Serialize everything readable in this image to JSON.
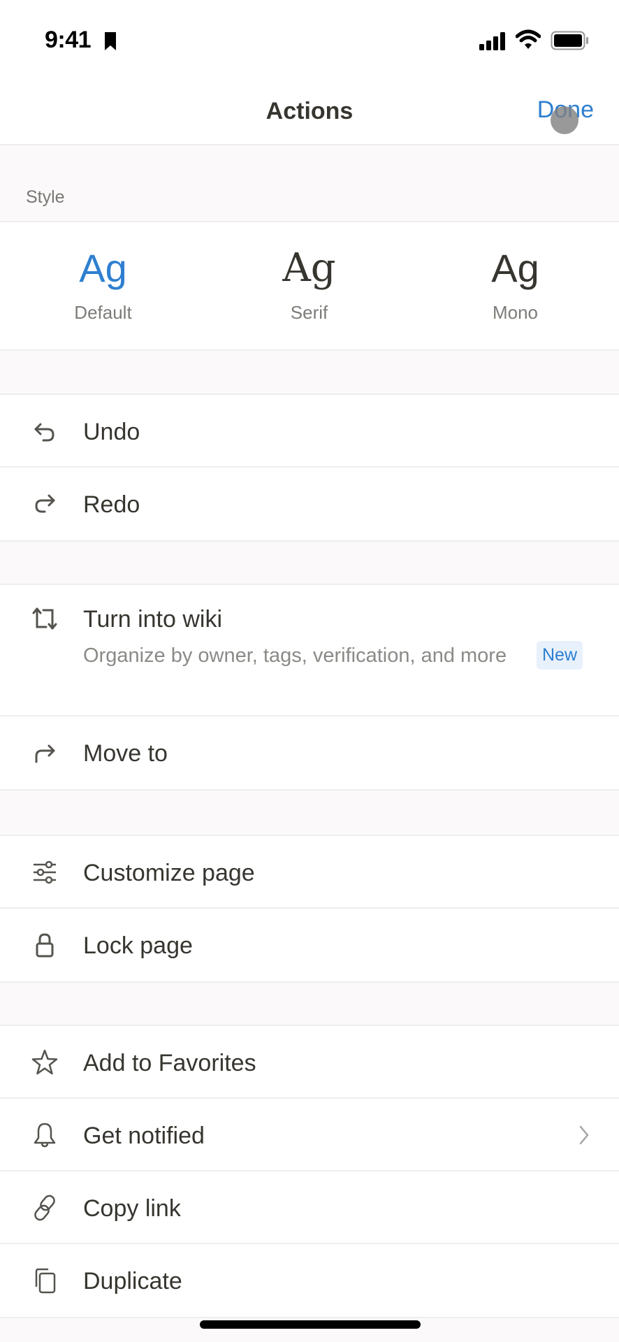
{
  "status_bar": {
    "time": "9:41",
    "icons": [
      "bookmark-icon",
      "cellular-signal-icon",
      "wifi-icon",
      "battery-icon"
    ]
  },
  "nav": {
    "title": "Actions",
    "done_label": "Done"
  },
  "style_section": {
    "header": "Style",
    "selected": "Default",
    "options": [
      {
        "glyph": "Ag",
        "label": "Default"
      },
      {
        "glyph": "Ag",
        "label": "Serif"
      },
      {
        "glyph": "Ag",
        "label": "Mono"
      }
    ]
  },
  "groups": [
    {
      "items": [
        {
          "icon": "undo-icon",
          "label": "Undo"
        },
        {
          "icon": "redo-icon",
          "label": "Redo"
        }
      ]
    },
    {
      "items": [
        {
          "icon": "turn-into-icon",
          "label": "Turn into wiki",
          "subtitle": "Organize by owner, tags, verification, and more",
          "badge": "New"
        },
        {
          "icon": "move-to-icon",
          "label": "Move to"
        }
      ]
    },
    {
      "items": [
        {
          "icon": "sliders-icon",
          "label": "Customize page"
        },
        {
          "icon": "lock-icon",
          "label": "Lock page"
        }
      ]
    },
    {
      "items": [
        {
          "icon": "star-icon",
          "label": "Add to Favorites"
        },
        {
          "icon": "bell-icon",
          "label": "Get notified",
          "has_chevron": true
        },
        {
          "icon": "link-icon",
          "label": "Copy link"
        },
        {
          "icon": "duplicate-icon",
          "label": "Duplicate"
        }
      ]
    }
  ],
  "colors": {
    "accent": "#2e7fd0",
    "text": "#37352f",
    "secondary_text": "#8b8a87",
    "badge_bg": "#e8f1fb",
    "background": "#fbf9f9"
  }
}
